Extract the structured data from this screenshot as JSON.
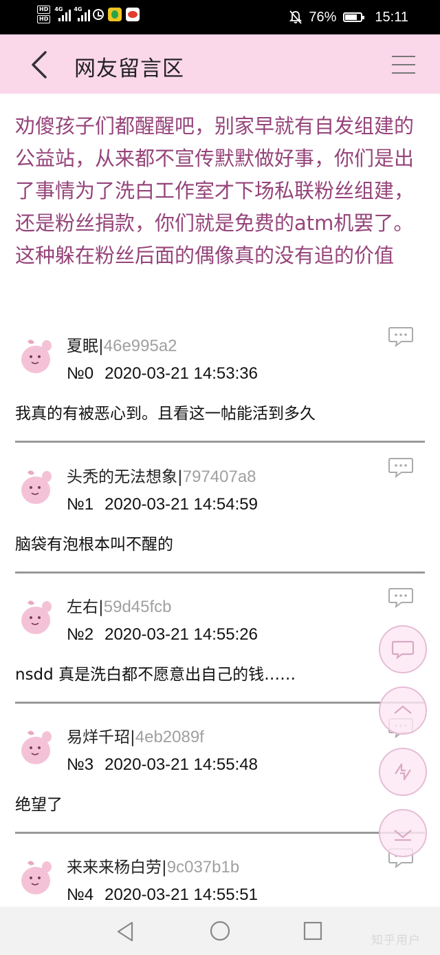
{
  "status_bar": {
    "hd_badges": [
      "HD",
      "HD"
    ],
    "network_1": "4G",
    "network_2": "4G",
    "battery_percent": "76%",
    "battery_level": 0.76,
    "time": "15:11",
    "icons": [
      "hd-icon",
      "signal-icon",
      "alarm-icon",
      "app-icon",
      "weibo-icon",
      "bell-off-icon",
      "battery-icon"
    ]
  },
  "header": {
    "title": "网友留言区",
    "background": "#fbd7ea",
    "back_icon": "chevron-left-icon",
    "menu_icon": "menu-icon"
  },
  "post": {
    "text": "劝傻孩子们都醒醒吧，别家早就有自发组建的公益站，从来都不宣传默默做好事，你们是出了事情为了洗白工作室才下场私联粉丝组建，还是粉丝捐款，你们就是免费的atm机罢了。这种躲在粉丝后面的偶像真的没有追的价值",
    "color": "#95447a"
  },
  "comments": [
    {
      "user": "夏眠",
      "sep": "|",
      "id": "46e995a2",
      "number": "№0",
      "datetime": "2020-03-21 14:53:36",
      "text": "我真的有被恶心到。且看这一帖能活到多久"
    },
    {
      "user": "头秃的无法想象",
      "sep": "|",
      "id": "797407a8",
      "number": "№1",
      "datetime": "2020-03-21 14:54:59",
      "text": "脑袋有泡根本叫不醒的"
    },
    {
      "user": "左右",
      "sep": "|",
      "id": "59d45fcb",
      "number": "№2",
      "datetime": "2020-03-21 14:55:26",
      "text": "nsdd 真是洗白都不愿意出自己的钱……"
    },
    {
      "user": "易烊千玿",
      "sep": "|",
      "id": "4eb2089f",
      "number": "№3",
      "datetime": "2020-03-21 14:55:48",
      "text": "绝望了"
    },
    {
      "user": "来来来杨白劳",
      "sep": "|",
      "id": "9c037b1b",
      "number": "№4",
      "datetime": "2020-03-21 14:55:51",
      "text": ""
    }
  ],
  "floating_buttons": [
    "comment-icon",
    "scroll-top-icon",
    "refresh-icon",
    "scroll-bottom-icon"
  ],
  "nav_bar": {
    "buttons": [
      "back-triangle-icon",
      "home-circle-icon",
      "recents-square-icon"
    ]
  },
  "watermark": "知乎用户"
}
